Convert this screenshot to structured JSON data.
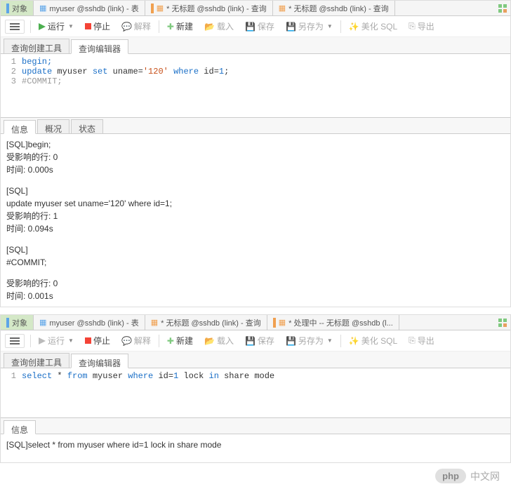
{
  "panel1": {
    "tabs": {
      "objects": "对象",
      "table": "myuser @sshdb (link) - 表",
      "query1": "* 无标题 @sshdb (link) - 查询",
      "query2": "* 无标题 @sshdb (link) - 查询"
    },
    "toolbar": {
      "run": "运行",
      "stop": "停止",
      "explain": "解释",
      "new": "新建",
      "load": "载入",
      "save": "保存",
      "saveas": "另存为",
      "beautify": "美化 SQL",
      "export": "导出"
    },
    "subtabs": {
      "builder": "查询创建工具",
      "editor": "查询编辑器"
    },
    "code": {
      "l1": {
        "n": "1",
        "t": "begin;"
      },
      "l2": {
        "n": "2",
        "pre": "update",
        "mid1": " myuser ",
        "set": "set",
        "mid2": " uname=",
        "str": "'120'",
        "mid3": " ",
        "where": "where",
        "mid4": " id=",
        "num": "1",
        "end": ";"
      },
      "l3": {
        "n": "3",
        "t": "#COMMIT;"
      }
    },
    "resultTabs": {
      "info": "信息",
      "profile": "概况",
      "status": "状态"
    },
    "result": {
      "r1": "[SQL]begin;",
      "r2": "受影响的行: 0",
      "r3": "时间: 0.000s",
      "r4": "[SQL]",
      "r5": "update myuser set uname='120' where id=1;",
      "r6": "受影响的行: 1",
      "r7": "时间: 0.094s",
      "r8": "[SQL]",
      "r9": "#COMMIT;",
      "r10": "受影响的行: 0",
      "r11": "时间: 0.001s"
    }
  },
  "panel2": {
    "tabs": {
      "objects": "对象",
      "table": "myuser @sshdb (link) - 表",
      "query1": "* 无标题 @sshdb (link) - 查询",
      "query2": "* 处理中 -- 无标题 @sshdb (l..."
    },
    "toolbar": {
      "run": "运行",
      "stop": "停止",
      "explain": "解释",
      "new": "新建",
      "load": "载入",
      "save": "保存",
      "saveas": "另存为",
      "beautify": "美化 SQL",
      "export": "导出"
    },
    "subtabs": {
      "builder": "查询创建工具",
      "editor": "查询编辑器"
    },
    "code": {
      "l1": {
        "n": "1",
        "sel": "select",
        "mid1": " * ",
        "from": "from",
        "mid2": " myuser ",
        "where": "where",
        "mid3": " id=",
        "num": "1",
        "mid4": " lock ",
        "in": "in",
        "mid5": " share mode"
      }
    },
    "resultTabs": {
      "info": "信息"
    },
    "result": {
      "r1": "[SQL]select * from myuser where id=1 lock in share mode"
    }
  },
  "watermark": {
    "badge": "php",
    "text": "中文网"
  }
}
